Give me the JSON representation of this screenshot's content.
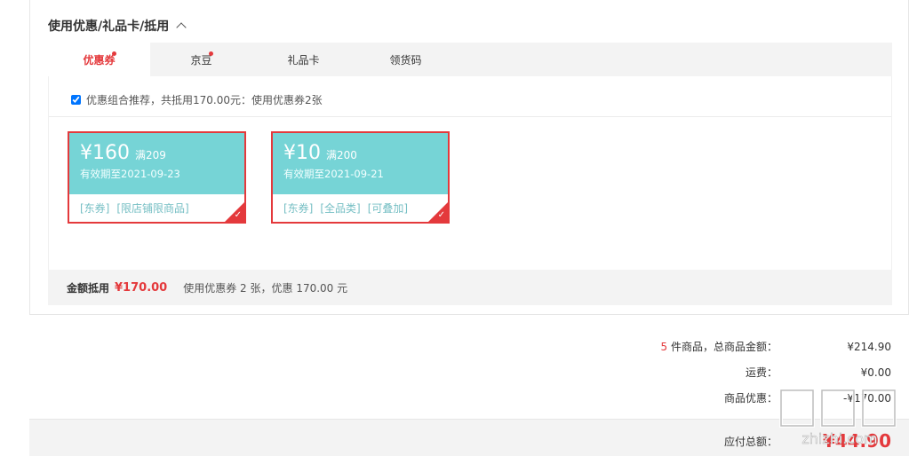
{
  "section": {
    "title": "使用优惠/礼品卡/抵用"
  },
  "tabs": [
    {
      "label": "优惠券",
      "dot": true,
      "active": true
    },
    {
      "label": "京豆",
      "dot": true,
      "active": false
    },
    {
      "label": "礼品卡",
      "dot": false,
      "active": false
    },
    {
      "label": "领货码",
      "dot": false,
      "active": false
    }
  ],
  "combo": {
    "label": "优惠组合推荐，共抵用170.00元：使用优惠券2张",
    "checked": true
  },
  "coupons": [
    {
      "amount": "¥160",
      "condition": "满209",
      "expiry": "有效期至2021-09-23",
      "tag1": "[东券]",
      "tag2": "[限店铺限商品]",
      "tag3": ""
    },
    {
      "amount": "¥10",
      "condition": "满200",
      "expiry": "有效期至2021-09-21",
      "tag1": "[东券]",
      "tag2": "[全品类]",
      "tag3": "[可叠加]"
    }
  ],
  "summary": {
    "label": "金额抵用",
    "amount": "¥170.00",
    "desc": "使用优惠券 2 张，优惠 170.00 元"
  },
  "totals": {
    "count": "5",
    "goods_label": " 件商品，总商品金额：",
    "goods_value": "¥214.90",
    "shipping_label": "运费：",
    "shipping_value": "¥0.00",
    "discount_label": "商品优惠：",
    "discount_value": "-¥170.00",
    "pay_label": "应付总额：",
    "pay_value": "¥44.90"
  },
  "watermark": {
    "text": "zhizhi.com"
  },
  "colors": {
    "accent": "#e4393c",
    "coupon_bg": "#76d4d6"
  }
}
